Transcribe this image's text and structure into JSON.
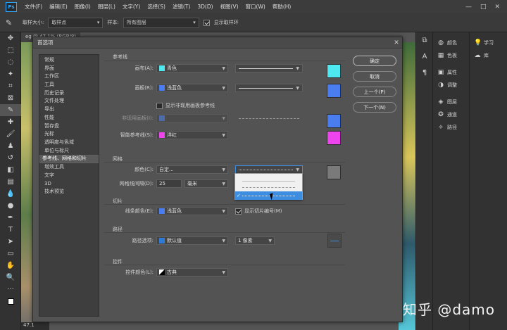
{
  "menubar": {
    "logo": "Ps",
    "items": [
      "文件(F)",
      "编辑(E)",
      "图像(I)",
      "图层(L)",
      "文字(Y)",
      "选择(S)",
      "滤镜(T)",
      "3D(D)",
      "视图(V)",
      "窗口(W)",
      "帮助(H)"
    ],
    "window_controls": [
      "—",
      "□",
      "✕"
    ]
  },
  "options_bar": {
    "sample_size_label": "取样大小:",
    "sample_size_value": "取样点",
    "sample_label": "样本:",
    "sample_value": "所有图层",
    "show_ring_label": "显示取样环",
    "show_ring_checked": true
  },
  "document": {
    "tab_label": "eg",
    "tab_info": "@ 47.1% (RGB/8)",
    "zoom": "47.1"
  },
  "dialog": {
    "title": "首选项",
    "close": "✕",
    "categories": [
      "常规",
      "界面",
      "工作区",
      "工具",
      "历史记录",
      "文件处理",
      "导出",
      "性能",
      "暂存盘",
      "光标",
      "透明度与色域",
      "单位与标尺",
      "参考线、网格和切片",
      "增效工具",
      "文字",
      "3D",
      "技术预览"
    ],
    "selected_category_index": 12,
    "buttons": {
      "ok": "确定",
      "cancel": "取消",
      "prev": "上一个(P)",
      "next": "下一个(N)"
    },
    "guides": {
      "title": "参考线",
      "canvas_label": "画布(A):",
      "canvas_color_name": "青色",
      "canvas_color": "#4ee8f0",
      "artboard_label": "画板(R):",
      "artboard_color_name": "浅蓝色",
      "artboard_color": "#4a7ef0",
      "show_artboard_guides_label": "显示非现用画板参考线",
      "show_artboard_guides_checked": false,
      "inactive_artboard_label": "非现用画板(I):",
      "inactive_artboard_color": "#4a7ef0",
      "smart_guides_label": "智能参考线(S):",
      "smart_guides_color_name": "洋红",
      "smart_guides_color": "#ee44ee"
    },
    "grid": {
      "title": "网格",
      "color_label": "颜色(C):",
      "color_value": "自定...",
      "preview_color": "#7a7a7a",
      "spacing_label": "网格线间隔(D):",
      "spacing_value": "25",
      "spacing_unit": "毫米"
    },
    "slices": {
      "title": "切片",
      "line_color_label": "线条颜色(E):",
      "line_color_name": "浅蓝色",
      "line_color": "#4a7ef0",
      "show_numbers_label": "显示切片编号(M)",
      "show_numbers_checked": true
    },
    "path": {
      "title": "路径",
      "options_label": "路径选项:",
      "color_name": "默认值",
      "color": "#2f7ad6",
      "width": "1 像素"
    },
    "controls": {
      "title": "控件",
      "color_label": "控件颜色(L):",
      "color_value": "古典"
    }
  },
  "right_panels": {
    "col1": [
      {
        "icon": "swatch-color-icon",
        "label": "颜色"
      },
      {
        "icon": "grid-swatches-icon",
        "label": "色板"
      },
      {
        "icon": "properties-icon",
        "label": "属性"
      },
      {
        "icon": "adjust-icon",
        "label": "调整"
      },
      {
        "icon": "layers-icon",
        "label": "图层"
      },
      {
        "icon": "channels-icon",
        "label": "通道"
      },
      {
        "icon": "paths-icon",
        "label": "路径"
      }
    ],
    "col2": [
      {
        "icon": "learn-icon",
        "label": "学习"
      },
      {
        "icon": "library-icon",
        "label": "库"
      }
    ]
  },
  "watermark": "知乎 @damo"
}
